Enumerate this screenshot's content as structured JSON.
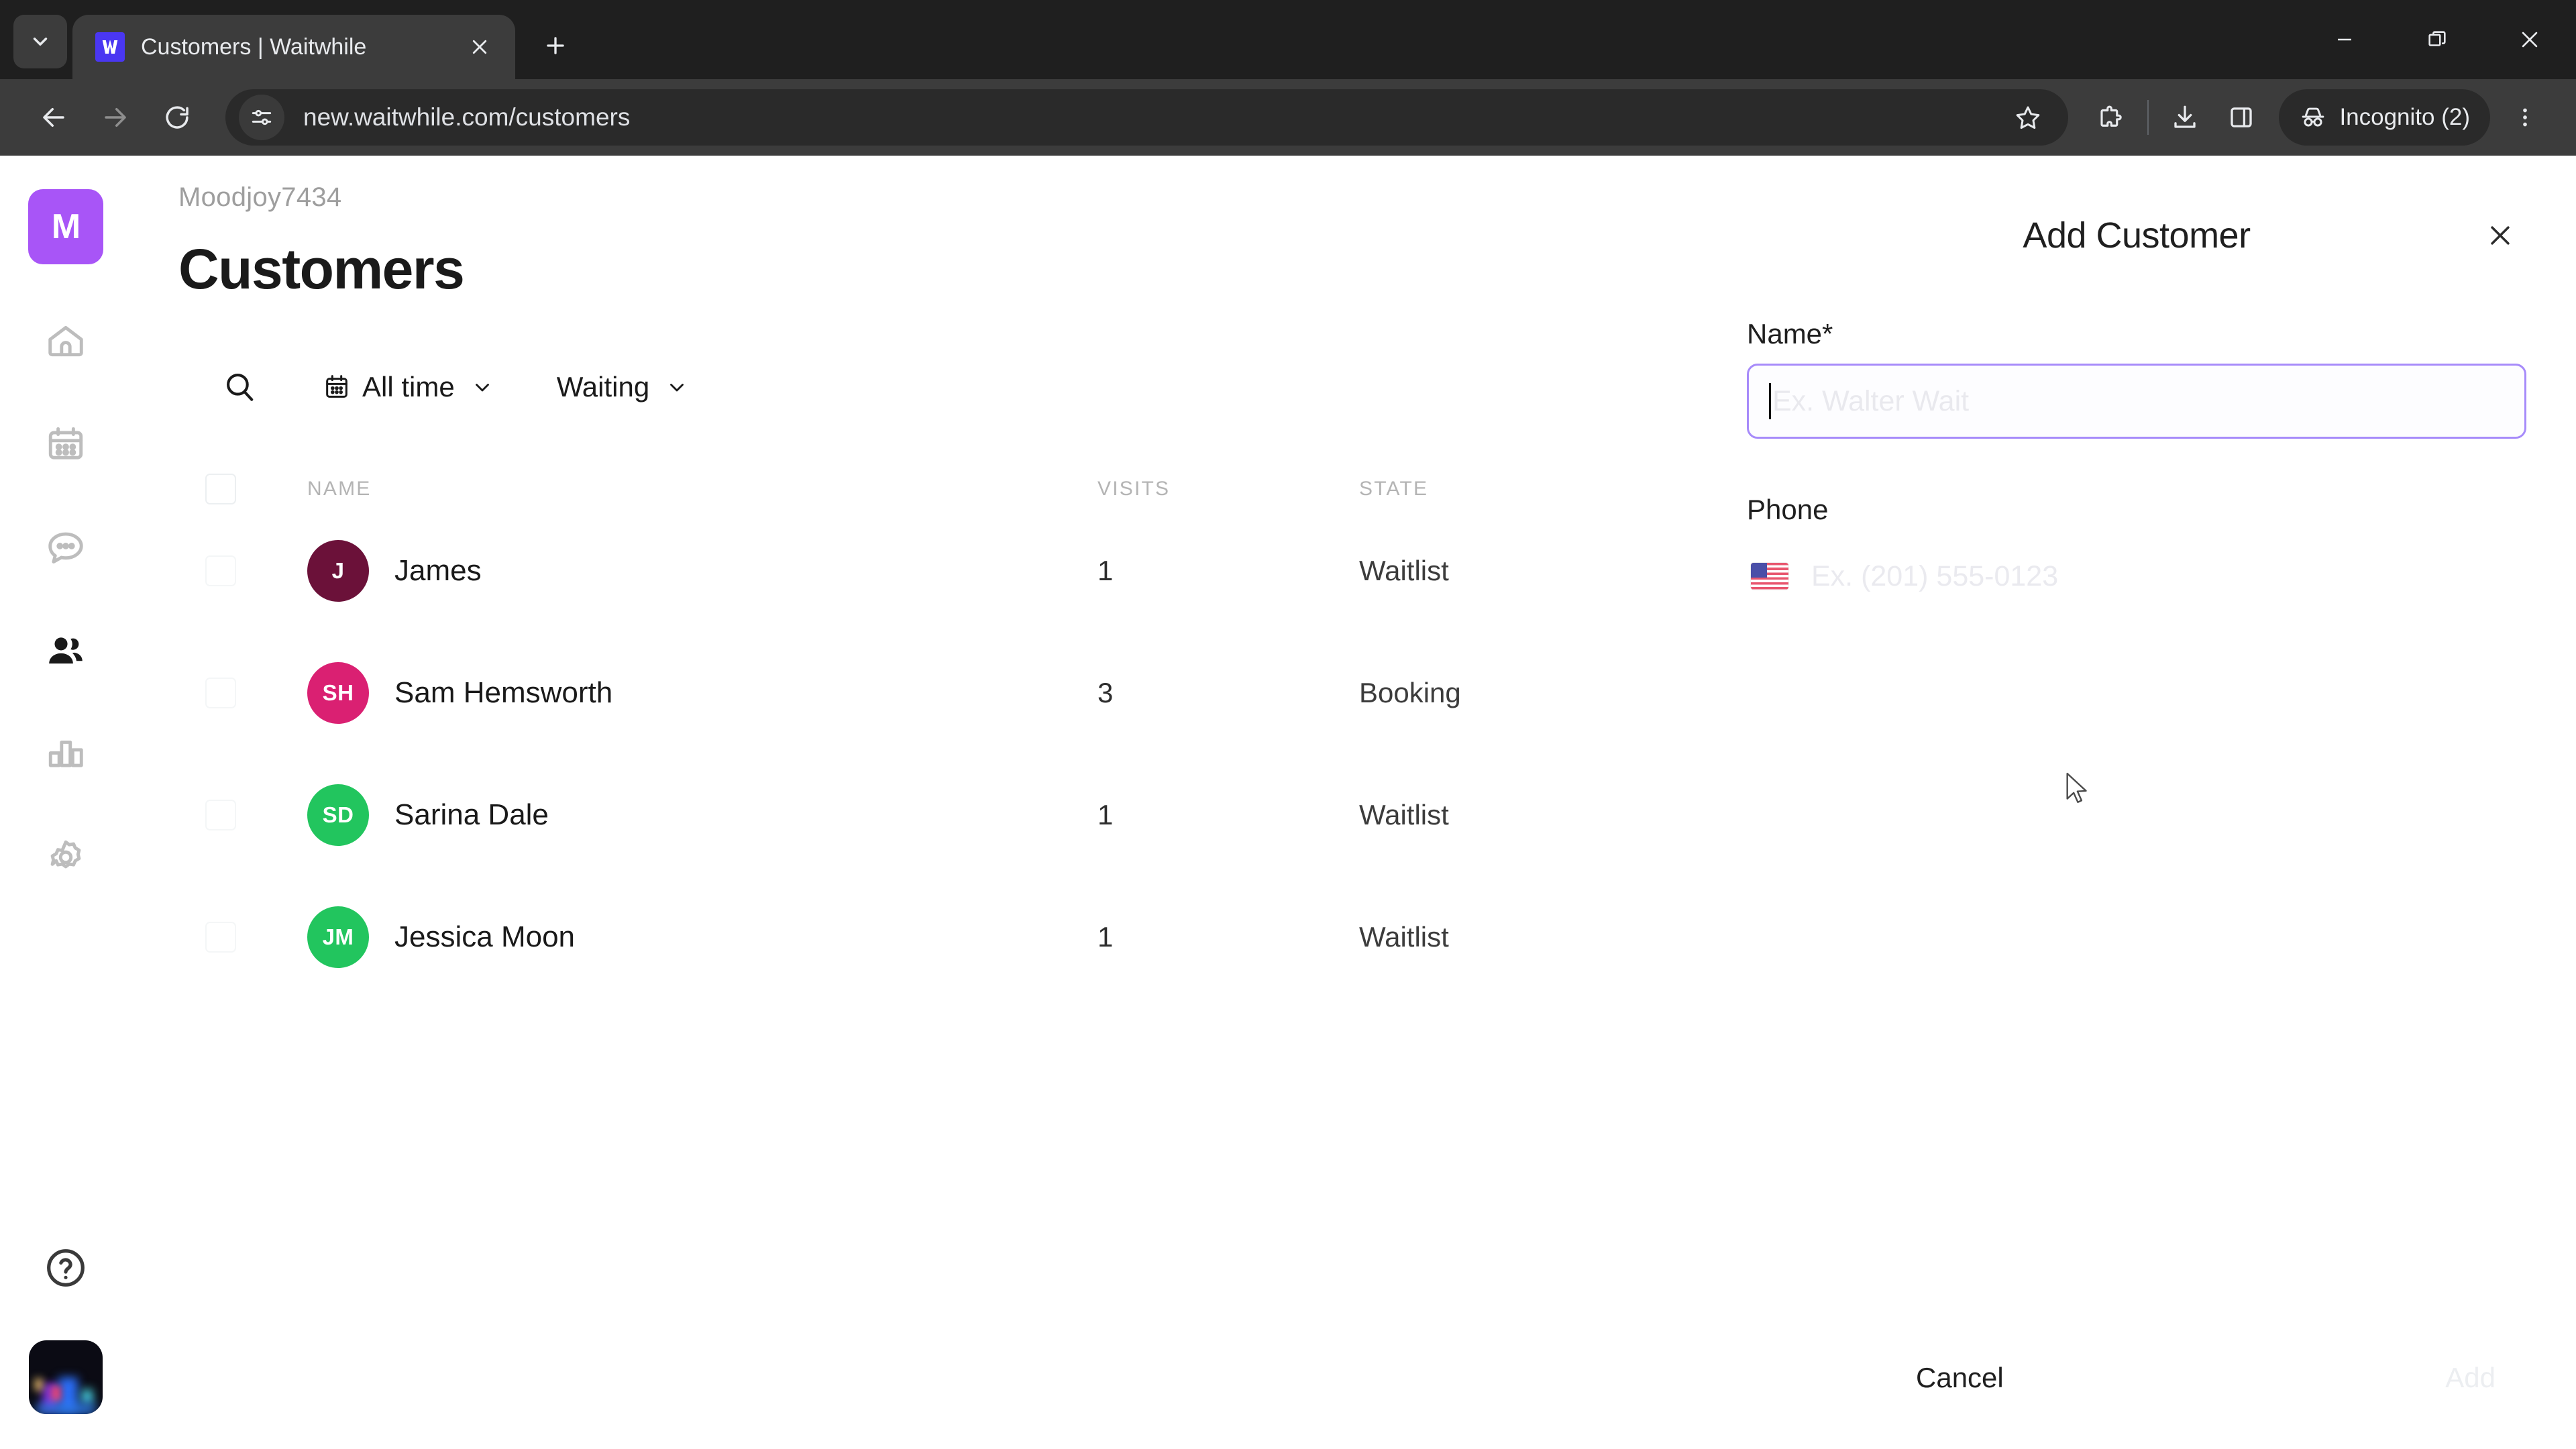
{
  "browser": {
    "tab": {
      "title": "Customers | Waitwhile",
      "favicon": "waitwhile-logo-icon"
    },
    "newtab_tooltip": "New tab",
    "url": "new.waitwhile.com/customers",
    "profile_label": "Incognito (2)",
    "window_controls": [
      "minimize",
      "restore",
      "close"
    ],
    "toolbar_icons": [
      "back-arrow",
      "forward-arrow",
      "reload",
      "site-settings",
      "bookmark-star",
      "extensions",
      "downloads",
      "side-panel",
      "incognito",
      "chrome-menu"
    ]
  },
  "sidebar": {
    "logo": "M",
    "logo_color": "#a855f7",
    "items": [
      {
        "name": "home",
        "icon": "home-icon",
        "active": false
      },
      {
        "name": "schedule",
        "icon": "calendar-icon",
        "active": false
      },
      {
        "name": "messages",
        "icon": "chat-bubble-icon",
        "active": false
      },
      {
        "name": "customers",
        "icon": "people-icon",
        "active": true
      },
      {
        "name": "analytics",
        "icon": "bar-chart-icon",
        "active": false
      },
      {
        "name": "settings",
        "icon": "gear-icon",
        "active": false
      }
    ],
    "help": "help-circle-icon",
    "avatar": "user-photo-avatar"
  },
  "main": {
    "org_name": "Moodjoy7434",
    "page_title": "Customers",
    "filters": {
      "search_icon": "search-icon",
      "date_filter": {
        "label": "All time",
        "icon": "calendar-icon",
        "chevron": "chevron-down-icon"
      },
      "status_filter": {
        "label": "Waiting",
        "chevron": "chevron-down-icon"
      }
    },
    "table": {
      "columns": [
        "NAME",
        "VISITS",
        "STATE"
      ],
      "rows": [
        {
          "initials": "J",
          "name": "James",
          "visits": "1",
          "state": "Waitlist",
          "color": "#6b1139"
        },
        {
          "initials": "SH",
          "name": "Sam Hemsworth",
          "visits": "3",
          "state": "Booking",
          "color": "#da2072"
        },
        {
          "initials": "SD",
          "name": "Sarina Dale",
          "visits": "1",
          "state": "Waitlist",
          "color": "#22c55e"
        },
        {
          "initials": "JM",
          "name": "Jessica Moon",
          "visits": "1",
          "state": "Waitlist",
          "color": "#22c55e"
        }
      ]
    }
  },
  "panel": {
    "title": "Add Customer",
    "close_icon": "close-icon",
    "name_label": "Name",
    "name_required_marker": "*",
    "name_value": "",
    "name_placeholder": "Ex. Walter Wait",
    "phone_label": "Phone",
    "phone_country_flag": "us-flag-icon",
    "phone_value": "",
    "phone_placeholder": "Ex. (201) 555-0123",
    "cancel_label": "Cancel",
    "add_label": "Add",
    "accent_color": "#a78bfa"
  }
}
